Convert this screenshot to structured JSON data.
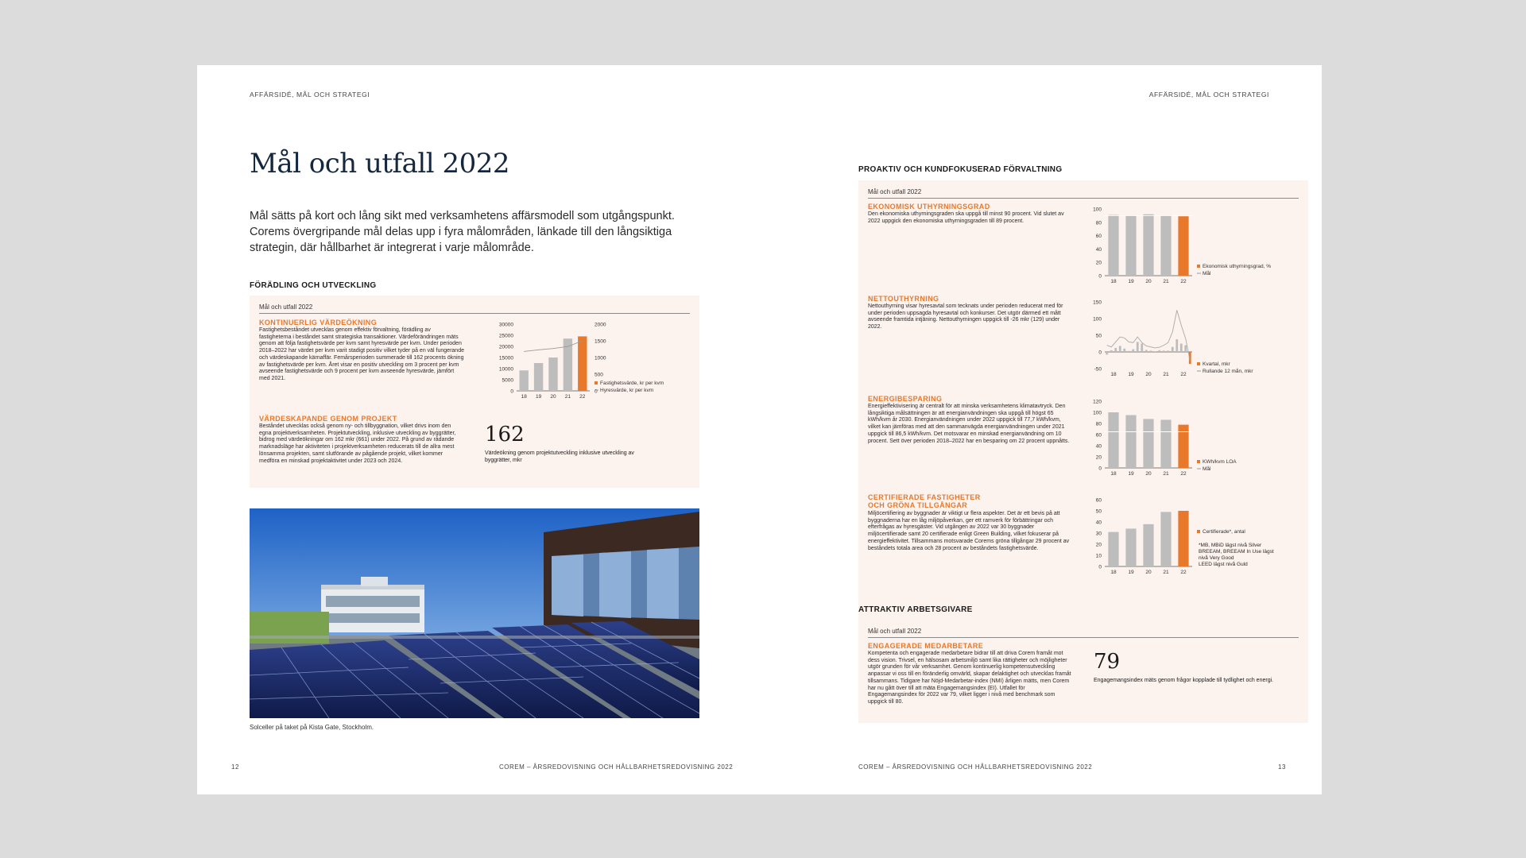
{
  "left": {
    "running_head": "AFFÄRSIDÉ, MÅL OCH STRATEGI",
    "title": "Mål och utfall 2022",
    "intro": "Mål sätts på kort och lång sikt med verksamhetens affärsmodell som utgångspunkt. Corems övergripande mål delas upp i fyra målområden, länkade till den långsiktiga strategin, där hållbarhet är integrerat i varje målområde.",
    "section": "FÖRÄDLING OCH UTVECKLING",
    "panel_label": "Mål och utfall 2022",
    "block1": {
      "heading": "KONTINUERLIG VÄRDEÖKNING",
      "text": "Fastighetsbeståndet utvecklas genom effektiv förvaltning, förädling av fastigheterna i beståndet samt strategiska transaktioner. Värdeförändringen mäts genom att följa fastighetsvärde per kvm samt hyresvärde per kvm. Under perioden 2018–2022 har värdet per kvm varit stadigt positiv vilket tyder på en väl fungerande och värdeskapande kärnaffär. Femårsperioden summerade till 162 procents ökning av fastighetsvärde per kvm. Året visar en positiv utveckling om 3 procent per kvm avseende fastighetsvärde och 9 procent per kvm avseende hyresvärde, jämfört med 2021."
    },
    "block2": {
      "heading": "VÄRDESKAPANDE GENOM PROJEKT",
      "text": "Beståndet utvecklas också genom ny- och tillbyggnation, vilket drivs inom den egna projektverksamheten. Projektutveckling, inklusive utveckling av byggrätter, bidrog med värdeökningar om 162 mkr (661) under 2022. På grund av rådande marknadsläge har aktiviteten i projektverksamheten reducerats till de allra mest lönsamma projekten, samt slutförande av pågående projekt, vilket kommer medföra en minskad projektaktivitet under 2023 och 2024.",
      "big_number": "162",
      "big_caption": "Värdeökning genom projektutveckling inklusive utveckling av byggrätter, mkr"
    },
    "photo_caption": "Solceller på taket på Kista Gate, Stockholm.",
    "page_number": "12",
    "footer": "COREM – ÅRSREDOVISNING OCH HÅLLBARHETSREDOVISNING 2022"
  },
  "right": {
    "running_head": "AFFÄRSIDÉ, MÅL OCH STRATEGI",
    "section1": "PROAKTIV OCH KUNDFOKUSERAD FÖRVALTNING",
    "panel_label": "Mål och utfall 2022",
    "blockA": {
      "heading": "EKONOMISK UTHYRNINGSGRAD",
      "text": "Den ekonomiska uthyrningsgraden ska uppgå till minst 90 procent. Vid slutet av 2022 uppgick den ekonomiska uthyrningsgraden till 89 procent."
    },
    "blockB": {
      "heading": "NETTOUTHYRNING",
      "text": "Nettouthyrning visar hyresavtal som tecknats under perioden reducerat med för under perioden uppsagda hyresavtal och konkurser. Det utgör därmed ett mått avseende framtida intjäning. Nettouthyrningen uppgick till -26 mkr (129) under 2022."
    },
    "blockC": {
      "heading": "ENERGIBESPARING",
      "text": "Energieffektivisering är centralt för att minska verksamhetens klimatavtryck. Den långsiktiga målsättningen är att energianvändningen ska uppgå till högst 65 kWh/kvm år 2030. Energianvändningen under 2022 uppgick till 77,7 kWh/kvm, vilket kan jämföras med att den sammanvägda energianvändningen under 2021 uppgick till 86,5 kWh/kvm. Det motsvarar en minskad energianvändning om 10 procent. Sett över perioden 2018–2022 har en besparing om 22 procent uppnåtts."
    },
    "blockD": {
      "heading_line1": "CERTIFIERADE FASTIGHETER",
      "heading_line2": "OCH GRÖNA TILLGÅNGAR",
      "text": "Miljöcertifiering av byggnader är viktigt ur flera aspekter. Det är ett bevis på att byggnaderna har en låg miljöpåverkan, ger ett ramverk för förbättringar och efterfrågas av hyresgäster. Vid utgången av 2022 var 30 byggnader miljöcertifierade samt 20 certifierade enligt Green Building, vilket fokuserar på energieffektivitet. Tillsammans motsvarade Corems gröna tillgångar 29 procent av beståndets totala area och 28 procent av beståndets fastighetsvärde.",
      "note1": "*MB, MBiD lägst nivå Silver",
      "note2": "BREEAM, BREEAM In Use lägst",
      "note3": "nivå Very Good",
      "note4": "LEED lägst nivå Guld"
    },
    "section2": "ATTRAKTIV ARBETSGIVARE",
    "panel2_label": "Mål och utfall 2022",
    "blockE": {
      "heading": "ENGAGERADE MEDARBETARE",
      "text": "Kompetenta och engagerade medarbetare bidrar till att driva Corem framåt mot dess vision. Trivsel, en hälsosam arbetsmiljö samt lika rättigheter och möjligheter utgör grunden för vår verksamhet. Genom kontinuerlig kompetensutveckling anpassar vi oss till en föränderlig omvärld, skapar delaktighet och utvecklas framåt tillsammans. Tidigare har Nöjd-Medarbetar-index (NMI) årligen mätts, men Corem har nu gått över till att mäta Engagemangsindex (EI). Utfallet för Engagemangsindex för 2022 var 79, vilket ligger i nivå med benchmark som uppgick till 80.",
      "big_number": "79",
      "big_caption": "Engagemangsindex mäts genom frågor kopplade till tydlighet och energi."
    },
    "page_number": "13",
    "footer": "COREM – ÅRSREDOVISNING OCH HÅLLBARHETSREDOVISNING 2022"
  },
  "colors": {
    "orange": "#e8782a",
    "grey_bar": "#bdbdbd",
    "panel": "#fcf2ee",
    "title": "#14273f"
  },
  "chart_data": [
    {
      "type": "bar",
      "categories": [
        "18",
        "19",
        "20",
        "21",
        "22"
      ],
      "series": [
        {
          "name": "Fastighetsvärde, kr per kvm",
          "values": [
            9200,
            12500,
            15000,
            23500,
            24500
          ]
        },
        {
          "name": "Hyresvärde, kr per kvm",
          "values": [
            1180,
            1230,
            1270,
            1330,
            1500
          ]
        }
      ],
      "yticks": [
        "30000",
        "25000",
        "20000",
        "15000",
        "10000",
        "5000",
        "0"
      ],
      "y2ticks": [
        "2000",
        "1500",
        "1000",
        "500",
        "0"
      ],
      "ylim": [
        0,
        30000
      ],
      "y2lim": [
        0,
        2000
      ]
    },
    {
      "type": "bar",
      "categories": [
        "18",
        "19",
        "20",
        "21",
        "22"
      ],
      "series": [
        {
          "name": "Ekonomisk uthyrningsgrad, %",
          "values": [
            91,
            90,
            92,
            90,
            89
          ]
        },
        {
          "name": "Mål",
          "values": [
            90
          ]
        }
      ],
      "yticks": [
        "100",
        "80",
        "60",
        "40",
        "20",
        "0"
      ],
      "ylim": [
        0,
        100
      ]
    },
    {
      "type": "bar",
      "categories": [
        "18",
        "19",
        "20",
        "21",
        "22"
      ],
      "series": [
        {
          "name": "Kvartal, mkr",
          "values": [
            -8,
            5,
            12,
            18,
            10,
            3,
            8,
            30,
            25,
            6,
            4,
            2,
            5,
            4,
            4,
            15,
            38,
            25,
            20,
            -36
          ]
        },
        {
          "name": "Rullande 12 mån, mkr",
          "values": [
            20,
            15,
            30,
            45,
            42,
            30,
            28,
            45,
            28,
            18,
            15,
            12,
            14,
            20,
            28,
            60,
            125,
            80,
            40,
            -26
          ]
        }
      ],
      "yticks": [
        "150",
        "100",
        "50",
        "0",
        "-50"
      ],
      "ylim": [
        -50,
        150
      ]
    },
    {
      "type": "bar",
      "categories": [
        "18",
        "19",
        "20",
        "21",
        "22"
      ],
      "series": [
        {
          "name": "KWh/kvm LOA",
          "values": [
            100,
            95,
            88,
            86.5,
            77.7
          ]
        },
        {
          "name": "Mål",
          "values": [
            65
          ]
        }
      ],
      "yticks": [
        "120",
        "100",
        "80",
        "60",
        "40",
        "20",
        "0"
      ],
      "ylim": [
        0,
        120
      ]
    },
    {
      "type": "bar",
      "categories": [
        "18",
        "19",
        "20",
        "21",
        "22"
      ],
      "series": [
        {
          "name": "Certifierade*, antal",
          "values": [
            31,
            34,
            38,
            49,
            50
          ]
        }
      ],
      "yticks": [
        "60",
        "50",
        "40",
        "30",
        "20",
        "10",
        "0"
      ],
      "ylim": [
        0,
        60
      ]
    }
  ]
}
